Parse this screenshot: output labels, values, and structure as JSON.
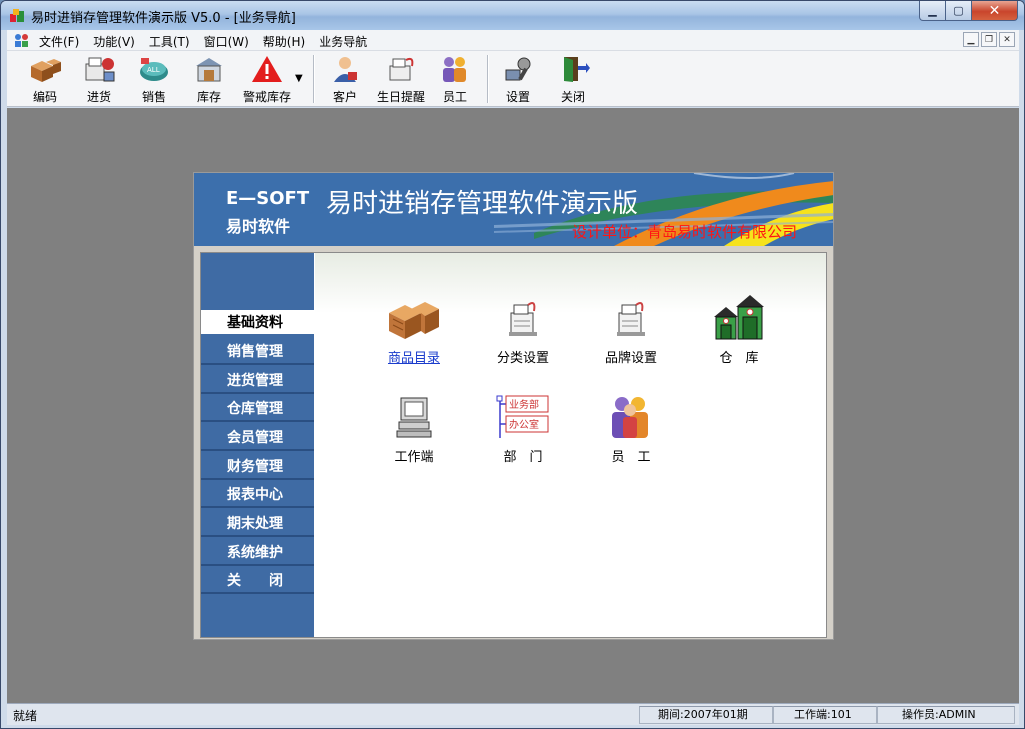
{
  "window": {
    "title": "易时进销存管理软件演示版 V5.0 - [业务导航]"
  },
  "menu": {
    "items": [
      "文件(F)",
      "功能(V)",
      "工具(T)",
      "窗口(W)",
      "帮助(H)",
      "业务导航"
    ]
  },
  "toolbar": {
    "buttons": [
      {
        "label": "编码",
        "icon": "boxes-icon"
      },
      {
        "label": "进货",
        "icon": "stock-in-icon"
      },
      {
        "label": "销售",
        "icon": "sales-icon"
      },
      {
        "label": "库存",
        "icon": "inventory-icon"
      },
      {
        "label": "警戒库存",
        "icon": "warning-icon"
      },
      {
        "label": "客户",
        "icon": "customer-icon"
      },
      {
        "label": "生日提醒",
        "icon": "birthday-icon"
      },
      {
        "label": "员工",
        "icon": "staff-icon"
      },
      {
        "label": "设置",
        "icon": "settings-icon"
      },
      {
        "label": "关闭",
        "icon": "exit-door-icon"
      }
    ]
  },
  "banner": {
    "brand_en": "E—SOFT",
    "brand_cn": "易时软件",
    "title": "易时进销存管理软件演示版",
    "subtitle": "设计单位：青岛易时软件有限公司"
  },
  "sidebar": {
    "items": [
      "基础资料",
      "销售管理",
      "进货管理",
      "仓库管理",
      "会员管理",
      "财务管理",
      "报表中心",
      "期末处理",
      "系统维护",
      "关　　闭"
    ],
    "active_index": 0
  },
  "tiles": [
    {
      "label": "商品目录",
      "icon": "goods-catalog-icon"
    },
    {
      "label": "分类设置",
      "icon": "category-icon"
    },
    {
      "label": "品牌设置",
      "icon": "brand-icon"
    },
    {
      "label": "仓　库",
      "icon": "warehouse-icon"
    },
    {
      "label": "工作端",
      "icon": "workstation-icon"
    },
    {
      "label": "部　门",
      "icon": "department-icon"
    },
    {
      "label": "员　工",
      "icon": "employees-icon"
    }
  ],
  "dept_icon": {
    "line1": "业务部",
    "line2": "办公室"
  },
  "status": {
    "ready": "就绪",
    "period": "期间:2007年01期",
    "terminal": "工作端:101",
    "operator": "操作员:ADMIN"
  }
}
